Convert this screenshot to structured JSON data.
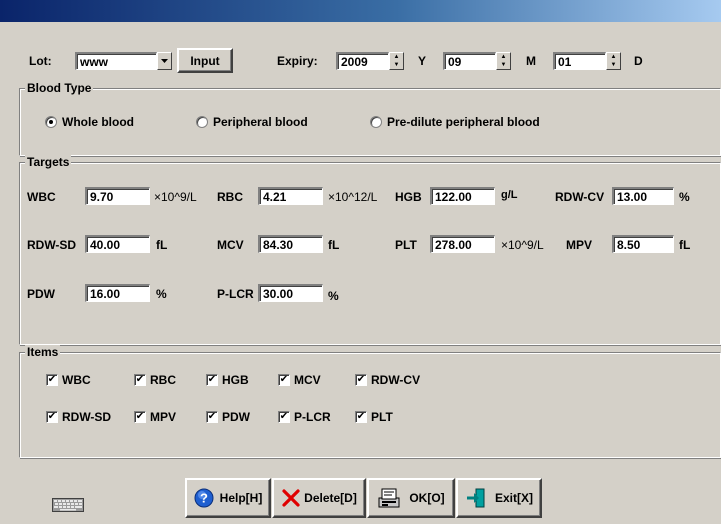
{
  "lot": {
    "label": "Lot:",
    "value": "www",
    "input_button": "Input"
  },
  "expiry": {
    "label": "Expiry:",
    "year": "2009",
    "year_unit": "Y",
    "month": "09",
    "month_unit": "M",
    "day": "01",
    "day_unit": "D"
  },
  "blood_type": {
    "title": "Blood Type",
    "options": [
      "Whole blood",
      "Peripheral blood",
      "Pre-dilute peripheral blood"
    ],
    "selected": "Whole blood"
  },
  "targets": {
    "title": "Targets",
    "fields": [
      {
        "label": "WBC",
        "value": "9.70",
        "unit": "×10^9/L"
      },
      {
        "label": "RBC",
        "value": "4.21",
        "unit": "×10^12/L"
      },
      {
        "label": "HGB",
        "value": "122.00",
        "unit": "g/L"
      },
      {
        "label": "RDW-CV",
        "value": "13.00",
        "unit": "%"
      },
      {
        "label": "RDW-SD",
        "value": "40.00",
        "unit": "fL"
      },
      {
        "label": "MCV",
        "value": "84.30",
        "unit": "fL"
      },
      {
        "label": "PLT",
        "value": "278.00",
        "unit": "×10^9/L"
      },
      {
        "label": "MPV",
        "value": "8.50",
        "unit": "fL"
      },
      {
        "label": "PDW",
        "value": "16.00",
        "unit": "%"
      },
      {
        "label": "P-LCR",
        "value": "30.00",
        "unit": "%"
      }
    ]
  },
  "items": {
    "title": "Items",
    "checkboxes": [
      {
        "label": "WBC",
        "checked": true
      },
      {
        "label": "RBC",
        "checked": true
      },
      {
        "label": "HGB",
        "checked": true
      },
      {
        "label": "MCV",
        "checked": true
      },
      {
        "label": "RDW-CV",
        "checked": true
      },
      {
        "label": "RDW-SD",
        "checked": true
      },
      {
        "label": "MPV",
        "checked": true
      },
      {
        "label": "PDW",
        "checked": true
      },
      {
        "label": "P-LCR",
        "checked": true
      },
      {
        "label": "PLT",
        "checked": true
      }
    ]
  },
  "buttons": {
    "help": "Help[H]",
    "delete": "Delete[D]",
    "ok": "OK[O]",
    "exit": "Exit[X]"
  },
  "icons": {
    "keyboard": "keyboard-icon",
    "help": "help-icon",
    "delete": "delete-x-icon",
    "ok": "ok-icon",
    "exit": "exit-icon"
  },
  "colors": {
    "dialog_face": "#d4d0c8",
    "title_start": "#0a246a",
    "title_end": "#a6caf0",
    "delete_red": "#e00000",
    "help_blue": "#1f5fd0"
  }
}
